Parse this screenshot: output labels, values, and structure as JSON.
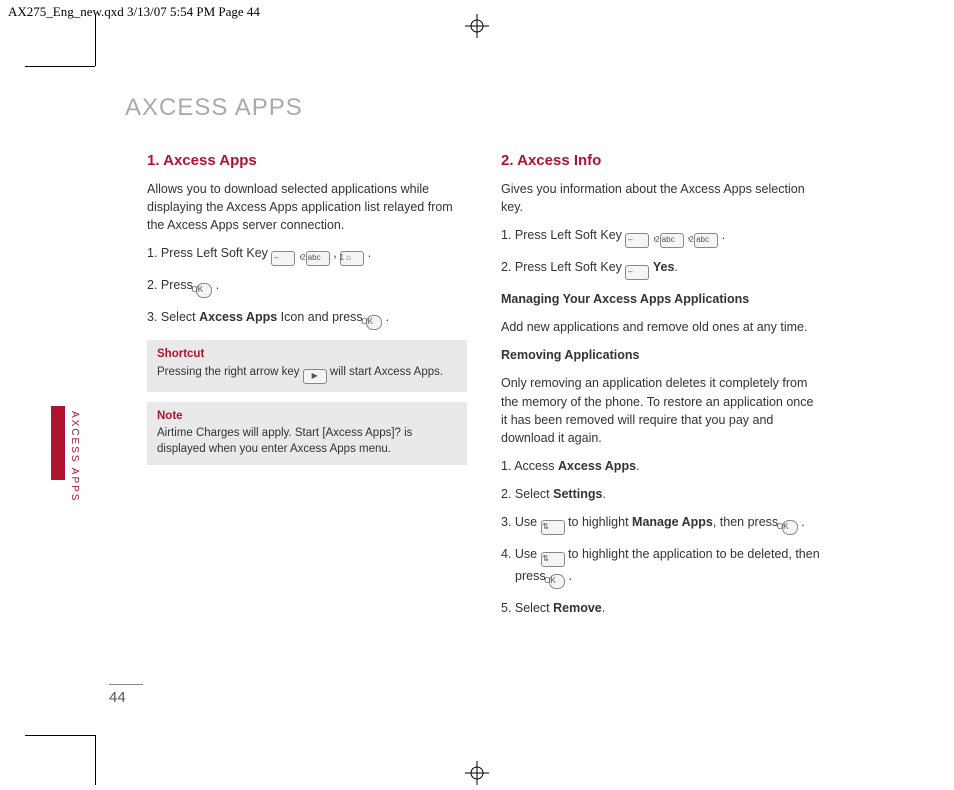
{
  "crop_header": "AX275_Eng_new.qxd  3/13/07  5:54 PM  Page 44",
  "chapter_title": "AXCESS APPS",
  "side_tab": "AXCESS APPS",
  "page_number": "44",
  "left": {
    "heading": "1. Axcess Apps",
    "intro": "Allows you to download selected applications while displaying the Axcess Apps application list relayed from the Axcess Apps server connection.",
    "step1_a": "1. Press Left Soft Key ",
    "step1_b": " , ",
    "step1_c": " , ",
    "step1_d": " .",
    "step2_a": "2. Press ",
    "step2_b": " .",
    "step3_a": "3. Select ",
    "step3_bold": "Axcess Apps",
    "step3_b": " Icon and press ",
    "step3_c": " .",
    "shortcut_title": "Shortcut",
    "shortcut_a": "Pressing the right arrow key ",
    "shortcut_b": " will start Axcess Apps.",
    "note_title": "Note",
    "note_body": "Airtime Charges will apply. Start [Axcess Apps]? is displayed when you enter Axcess Apps menu."
  },
  "right": {
    "heading": "2. Axcess Info",
    "intro": "Gives you information about the Axcess Apps selection key.",
    "step1_a": "1. Press Left Soft Key ",
    "step1_b": " , ",
    "step1_c": " , ",
    "step1_d": " .",
    "step2_a": "2. Press Left Soft Key ",
    "step2_bold": "Yes",
    "step2_b": ".",
    "sub1": "Managing Your Axcess Apps Applications",
    "sub1_body": "Add new applications and remove old ones at any time.",
    "sub2": "Removing Applications",
    "sub2_body": "Only removing an application deletes it completely from the memory of the phone. To restore an application once it has been removed will require that you pay and download it again.",
    "rs1_a": "1. Access ",
    "rs1_bold": "Axcess Apps",
    "rs1_b": ".",
    "rs2_a": "2. Select ",
    "rs2_bold": "Settings",
    "rs2_b": ".",
    "rs3_a": "3. Use ",
    "rs3_mid": " to highlight ",
    "rs3_bold": "Manage Apps",
    "rs3_b": ", then press ",
    "rs3_c": " .",
    "rs4_a": "4. Use ",
    "rs4_b": " to highlight the application to be deleted, then press ",
    "rs4_c": " .",
    "rs5_a": "5.  Select ",
    "rs5_bold": "Remove",
    "rs5_b": "."
  },
  "icons": {
    "softkey": "–",
    "key2": "2 abc",
    "key1": "1 ⌂",
    "ok": "OK",
    "right": "▶",
    "updown": "⇅"
  }
}
